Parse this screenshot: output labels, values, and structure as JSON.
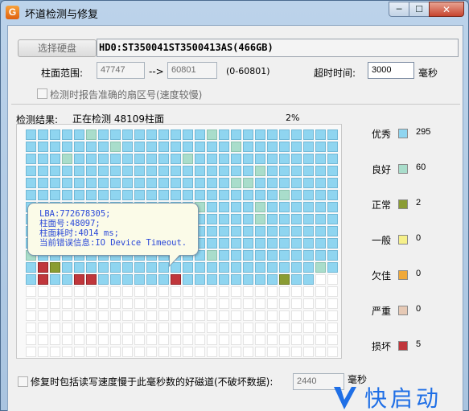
{
  "window": {
    "title": "坏道检测与修复",
    "app_icon_letter": "G",
    "minimize_glyph": "─",
    "maximize_glyph": "☐",
    "close_glyph": "✕"
  },
  "disk": {
    "select_button": "选择硬盘",
    "disk_name": "HD0:ST350041ST3500413AS(466GB)"
  },
  "range": {
    "label": "柱面范围:",
    "start": "47747",
    "arrow": "-->",
    "end": "60801",
    "hint": "(0-60801)"
  },
  "timeout": {
    "label": "超时时间:",
    "value": "3000",
    "unit": "毫秒"
  },
  "report_option": {
    "label": "检测时报告准确的扇区号(速度较慢)",
    "checked": false
  },
  "status": {
    "label": "检测结果:",
    "text": "正在检测 48109柱面",
    "percent": "2%"
  },
  "tooltip": {
    "line1": "LBA:772678305;",
    "line2": "柱面号:48097;",
    "line3": "柱面耗时:4014 ms;",
    "line4": "当前错误信息:IO Device Timeout."
  },
  "legend": [
    {
      "name": "优秀",
      "count": "295",
      "color": "#8fd5f0"
    },
    {
      "name": "良好",
      "count": "60",
      "color": "#a9ddcb"
    },
    {
      "name": "正常",
      "count": "2",
      "color": "#8a9c33"
    },
    {
      "name": "一般",
      "count": "0",
      "color": "#f6f08a"
    },
    {
      "name": "欠佳",
      "count": "0",
      "color": "#f0a93a"
    },
    {
      "name": "严重",
      "count": "0",
      "color": "#e6c9b5"
    },
    {
      "name": "损坏",
      "count": "5",
      "color": "#c0363b"
    }
  ],
  "repair_option": {
    "label": "修复时包括读写速度慢于此毫秒数的好磁道(不破坏数据):",
    "value": "2440",
    "unit": "毫秒",
    "checked": false
  },
  "watermark": {
    "text": "快启动"
  },
  "grid": {
    "columns": 26,
    "rows": 19,
    "pattern": [
      "EEEEEGEEEEEEEEEGEEEEEEEEEE",
      "EEEEEEEGEEEEEEEEEGEEEEEEEE",
      "EEEGEEEEEEEEEGEEEEEEEEEEEE",
      "EEEEEEEEEEEEEEEEEEEGEEEEEE",
      "EEEEEEEEEEEEEEEEEGGEEEEEEE",
      "EEEEEEEEEEEEEEEEEEEEEGEEEE",
      "EEEEEEEEEEEEEEGEEEEGEEEEEE",
      "EEEEEEEEEEEEEEEEEEEGEEEEEE",
      "EEEEEEEEEEEEEEEEEEEEEEEEEE",
      "EEEEEEEEEEEEEEEEEEEEEEEEEE",
      "GEEEEEEEEEEEEEEGEEEEEEEEEE",
      "EBNEEEEEEEEEEEEEEEEEEEEEGE",
      "EBEEBBEEEEEEBEEEEEEEENEE..",
      "..........................",
      "..........................",
      "..........................",
      "..........................",
      "..........................",
      ".........................."
    ]
  }
}
